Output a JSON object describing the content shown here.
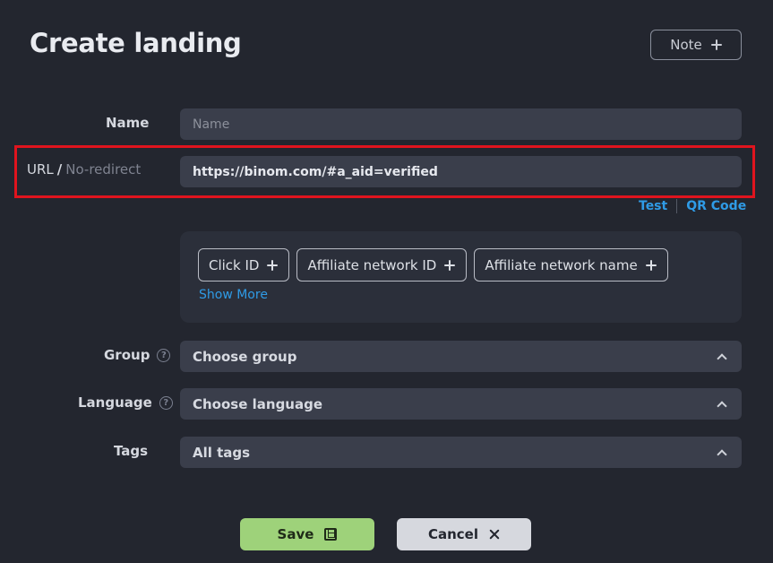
{
  "header": {
    "title": "Create landing",
    "note_label": "Note"
  },
  "form": {
    "name": {
      "label": "Name",
      "placeholder": "Name",
      "value": ""
    },
    "url": {
      "label": "URL",
      "separator": "/",
      "alt_label": "No-redirect",
      "value": "https://binom.com/#a_aid=verified",
      "test_label": "Test",
      "qr_label": "QR Code"
    },
    "tokens": {
      "chips": [
        "Click ID",
        "Affiliate network ID",
        "Affiliate network name"
      ],
      "show_more": "Show More"
    },
    "group": {
      "label": "Group",
      "value": "Choose group",
      "help": "?"
    },
    "language": {
      "label": "Language",
      "value": "Choose language",
      "help": "?"
    },
    "tags": {
      "label": "Tags",
      "value": "All tags"
    }
  },
  "actions": {
    "save_label": "Save",
    "cancel_label": "Cancel"
  },
  "colors": {
    "background": "#23262f",
    "field": "#3a3e4b",
    "link": "#2f9be6",
    "save": "#9ed27a",
    "cancel": "#d6d8de",
    "highlight": "#e0141e"
  }
}
